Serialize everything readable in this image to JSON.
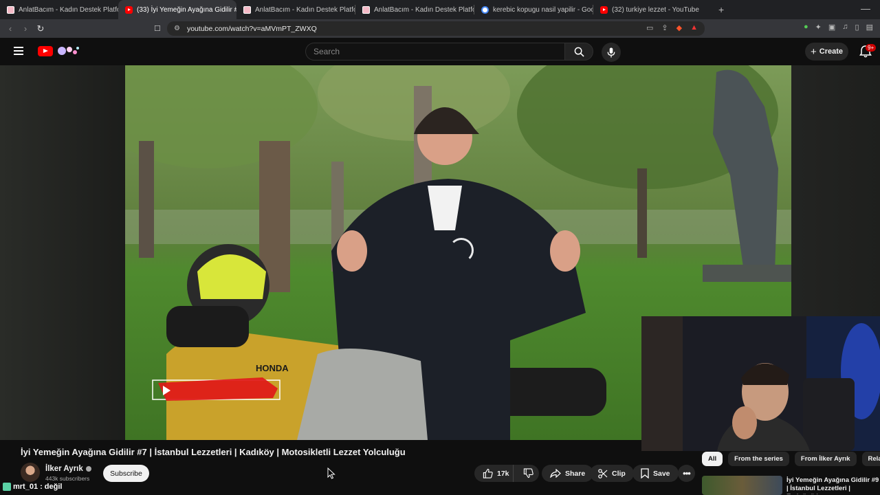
{
  "browser": {
    "tabs": [
      {
        "label": "AnlatBacım - Kadın Destek Platformu",
        "icon": "anlatbacim-favicon",
        "active": false
      },
      {
        "label": "(33) İyi Yemeğin Ayağına Gidilir #",
        "icon": "youtube-favicon",
        "active": true
      },
      {
        "label": "AnlatBacım - Kadın Destek Platformu",
        "icon": "anlatbacim-favicon",
        "active": false
      },
      {
        "label": "AnlatBacım - Kadın Destek Platformu",
        "icon": "anlatbacim-favicon",
        "active": false
      },
      {
        "label": "kerebic kopugu nasil yapilir - Google",
        "icon": "google-favicon",
        "active": false
      },
      {
        "label": "(32) turkiye lezzet - YouTube",
        "icon": "youtube-favicon",
        "active": false
      }
    ],
    "url": "youtube.com/watch?v=aMVmPT_ZWXQ"
  },
  "youtube": {
    "search_placeholder": "Search",
    "create_label": "Create",
    "notifications_badge": "9+"
  },
  "video": {
    "title": "İyi Yemeğin Ayağına Gidilir #7 | İstanbul Lezzetleri | Kadıköy | Motosikletli Lezzet Yolculuğu",
    "channel": "İlker Ayrık",
    "subscribers": "443k subscribers",
    "subscribe_label": "Subscribe",
    "likes": "17k",
    "share_label": "Share",
    "clip_label": "Clip",
    "save_label": "Save",
    "overlay_text": "HONDA"
  },
  "sidebar": {
    "chips": [
      "All",
      "From the series",
      "From İlker Ayrık",
      "Rela"
    ],
    "recommended_title": "İyi Yemeğin Ayağına Gidilir #9 | İstanbul Lezzetleri | Eminönü |"
  },
  "chat": {
    "user": "mrt_01",
    "message": ": değil"
  },
  "colors": {
    "youtube_red": "#ff0000",
    "page_bg": "#0f0f0f",
    "pill_bg": "#272727"
  }
}
